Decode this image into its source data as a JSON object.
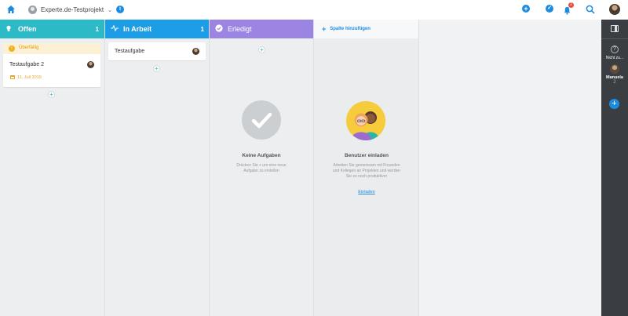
{
  "topbar": {
    "project_name": "Experte.de-Testprojekt",
    "notification_count": "2"
  },
  "columns": [
    {
      "title": "Offen",
      "count": "1",
      "color": "#2bbac6"
    },
    {
      "title": "In Arbeit",
      "count": "1",
      "color": "#1d9de5"
    },
    {
      "title": "Erledigt",
      "count": "",
      "color": "#9b84e2"
    }
  ],
  "add_column": {
    "label": "Spalte hinzufügen"
  },
  "cards": {
    "open_task": {
      "overdue_label": "Überfällig",
      "title": "Testaufgabe 2",
      "date": "11. Juli 2019"
    },
    "in_progress_task": {
      "title": "Testaufgabe"
    }
  },
  "empty_state": {
    "title": "Keine Aufgaben",
    "text": "Drücken Sie + um eine neue Aufgabe zu erstellen"
  },
  "invite": {
    "title": "Benutzer einladen",
    "text": "Arbeiten Sie gemeinsam mit Freunden und Kollegen an Projekten und werden Sie so noch produktiver",
    "link": "Einladen"
  },
  "sidebar": {
    "unassigned_label": "Nicht zu...",
    "member_name": "Manuela",
    "member_count": "2"
  },
  "icons": {
    "home": "home-icon",
    "info": "info-icon",
    "add": "plus-icon",
    "check": "check-icon",
    "bell": "bell-icon",
    "search": "search-icon",
    "panel": "panel-toggle-icon"
  }
}
